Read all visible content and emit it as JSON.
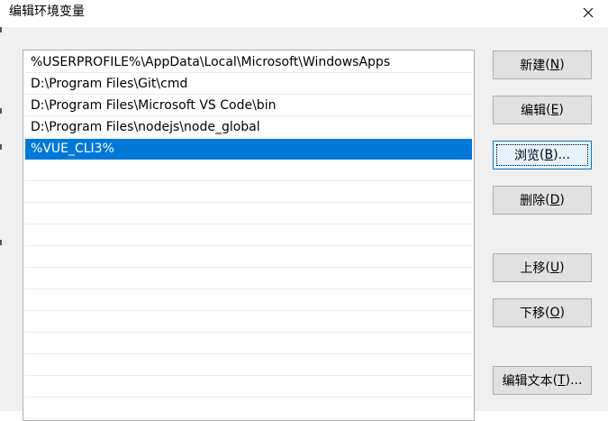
{
  "window": {
    "title": "编辑环境变量",
    "close_glyph": "✕"
  },
  "paths": [
    {
      "value": "%USERPROFILE%\\AppData\\Local\\Microsoft\\WindowsApps",
      "selected": false
    },
    {
      "value": "D:\\Program Files\\Git\\cmd",
      "selected": false
    },
    {
      "value": "D:\\Program Files\\Microsoft VS Code\\bin",
      "selected": false
    },
    {
      "value": "D:\\Program Files\\nodejs\\node_global",
      "selected": false
    },
    {
      "value": "%VUE_CLI3%",
      "selected": true
    }
  ],
  "buttons": {
    "new": {
      "label": "新建",
      "key": "N"
    },
    "edit": {
      "label": "编辑",
      "key": "E"
    },
    "browse": {
      "label": "浏览",
      "key": "B",
      "suffix": "..."
    },
    "delete": {
      "label": "删除",
      "key": "D"
    },
    "move_up": {
      "label": "上移",
      "key": "U"
    },
    "move_down": {
      "label": "下移",
      "key": "O"
    },
    "edit_text": {
      "label": "编辑文本",
      "key": "T",
      "suffix": "..."
    }
  },
  "colors": {
    "selection": "#0078d7",
    "client_bg": "#f0f0f0",
    "button_bg": "#e1e1e1"
  }
}
